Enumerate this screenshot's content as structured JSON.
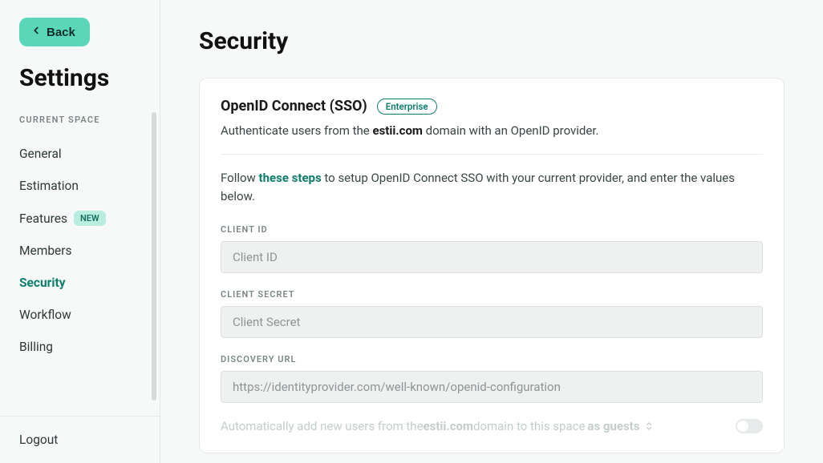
{
  "sidebar": {
    "back_label": "Back",
    "title": "Settings",
    "section_label": "CURRENT SPACE",
    "items": [
      {
        "label": "General"
      },
      {
        "label": "Estimation"
      },
      {
        "label": "Features",
        "badge": "NEW"
      },
      {
        "label": "Members"
      },
      {
        "label": "Security",
        "active": true
      },
      {
        "label": "Workflow"
      },
      {
        "label": "Billing"
      }
    ],
    "logout_label": "Logout"
  },
  "page": {
    "title": "Security"
  },
  "sso": {
    "card_title": "OpenID Connect (SSO)",
    "tier_pill": "Enterprise",
    "desc_prefix": "Authenticate users from the ",
    "desc_domain": "estii.com",
    "desc_suffix": " domain with an OpenID provider.",
    "instruction_prefix": "Follow ",
    "instruction_link": "these steps",
    "instruction_suffix": " to setup OpenID Connect SSO with your current provider, and enter the values below.",
    "fields": {
      "client_id": {
        "label": "CLIENT ID",
        "placeholder": "Client ID",
        "value": ""
      },
      "client_secret": {
        "label": "CLIENT SECRET",
        "placeholder": "Client Secret",
        "value": ""
      },
      "discovery_url": {
        "label": "DISCOVERY URL",
        "placeholder": "https://identityprovider.com/well-known/openid-configuration",
        "value": ""
      }
    },
    "auto_add": {
      "prefix": "Automatically add new users from the ",
      "domain": "estii.com",
      "middle": " domain to this space ",
      "role": "as guests",
      "enabled": false
    }
  }
}
